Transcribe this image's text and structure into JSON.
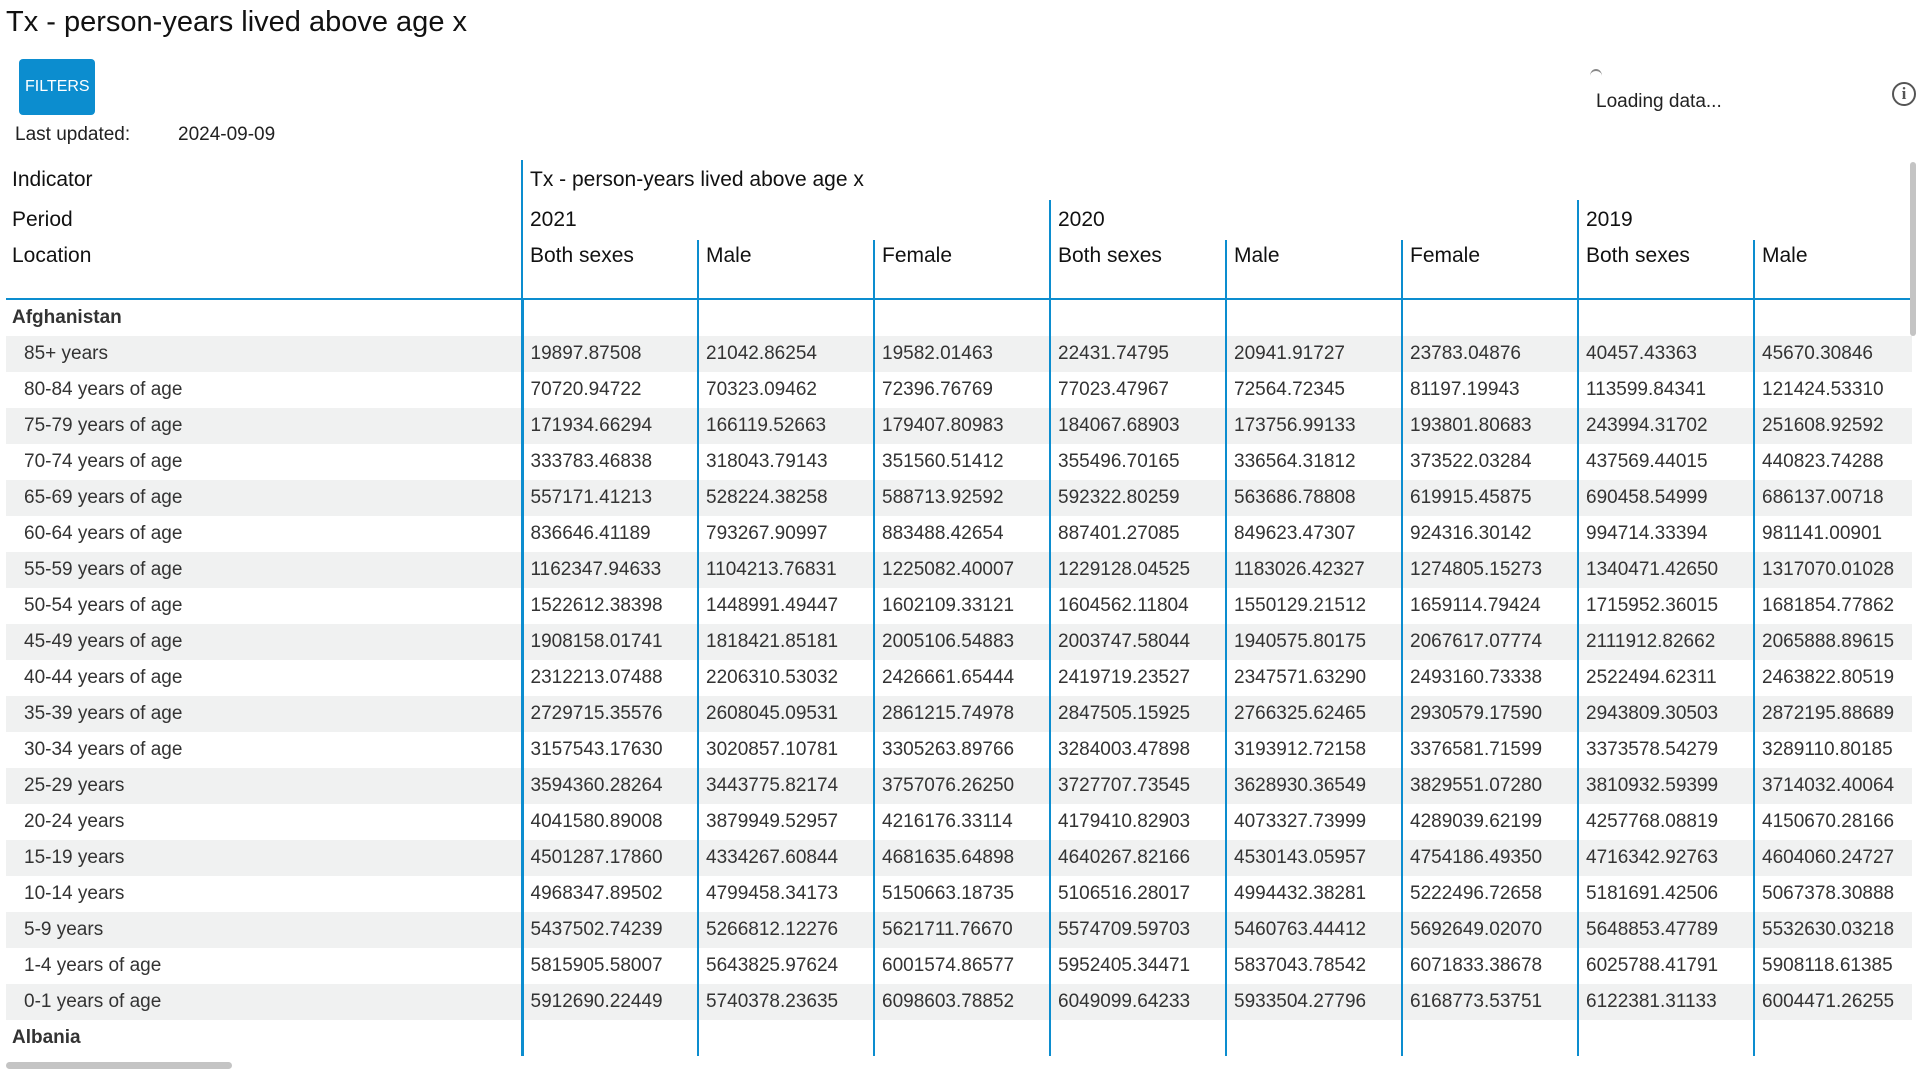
{
  "page": {
    "title": "Tx - person-years lived above age x",
    "filters_label": "FILTERS",
    "last_updated_label": "Last updated:",
    "last_updated_value": "2024-09-09",
    "loading_text": "Loading data...",
    "info_icon": "info-icon"
  },
  "table": {
    "header_labels": {
      "indicator": "Indicator",
      "period": "Period",
      "location": "Location"
    },
    "indicator_value": "Tx - person-years lived above age x",
    "periods": [
      {
        "label": "2021",
        "span": 3
      },
      {
        "label": "2020",
        "span": 3
      },
      {
        "label": "2019",
        "span": 2
      }
    ],
    "sexes": [
      "Both sexes",
      "Male",
      "Female",
      "Both sexes",
      "Male",
      "Female",
      "Both sexes",
      "Male"
    ],
    "groups": [
      {
        "location": "Afghanistan",
        "rows": [
          {
            "age": "85+ years",
            "values": [
              "19897.87508",
              "21042.86254",
              "19582.01463",
              "22431.74795",
              "20941.91727",
              "23783.04876",
              "40457.43363",
              "45670.30846"
            ]
          },
          {
            "age": "80-84 years of age",
            "values": [
              "70720.94722",
              "70323.09462",
              "72396.76769",
              "77023.47967",
              "72564.72345",
              "81197.19943",
              "113599.84341",
              "121424.53310"
            ]
          },
          {
            "age": "75-79 years of age",
            "values": [
              "171934.66294",
              "166119.52663",
              "179407.80983",
              "184067.68903",
              "173756.99133",
              "193801.80683",
              "243994.31702",
              "251608.92592"
            ]
          },
          {
            "age": "70-74 years of age",
            "values": [
              "333783.46838",
              "318043.79143",
              "351560.51412",
              "355496.70165",
              "336564.31812",
              "373522.03284",
              "437569.44015",
              "440823.74288"
            ]
          },
          {
            "age": "65-69 years of age",
            "values": [
              "557171.41213",
              "528224.38258",
              "588713.92592",
              "592322.80259",
              "563686.78808",
              "619915.45875",
              "690458.54999",
              "686137.00718"
            ]
          },
          {
            "age": "60-64 years of age",
            "values": [
              "836646.41189",
              "793267.90997",
              "883488.42654",
              "887401.27085",
              "849623.47307",
              "924316.30142",
              "994714.33394",
              "981141.00901"
            ]
          },
          {
            "age": "55-59 years of age",
            "values": [
              "1162347.94633",
              "1104213.76831",
              "1225082.40007",
              "1229128.04525",
              "1183026.42327",
              "1274805.15273",
              "1340471.42650",
              "1317070.01028"
            ]
          },
          {
            "age": "50-54 years of age",
            "values": [
              "1522612.38398",
              "1448991.49447",
              "1602109.33121",
              "1604562.11804",
              "1550129.21512",
              "1659114.79424",
              "1715952.36015",
              "1681854.77862"
            ]
          },
          {
            "age": "45-49 years of age",
            "values": [
              "1908158.01741",
              "1818421.85181",
              "2005106.54883",
              "2003747.58044",
              "1940575.80175",
              "2067617.07774",
              "2111912.82662",
              "2065888.89615"
            ]
          },
          {
            "age": "40-44 years of age",
            "values": [
              "2312213.07488",
              "2206310.53032",
              "2426661.65444",
              "2419719.23527",
              "2347571.63290",
              "2493160.73338",
              "2522494.62311",
              "2463822.80519"
            ]
          },
          {
            "age": "35-39 years of age",
            "values": [
              "2729715.35576",
              "2608045.09531",
              "2861215.74978",
              "2847505.15925",
              "2766325.62465",
              "2930579.17590",
              "2943809.30503",
              "2872195.88689"
            ]
          },
          {
            "age": "30-34 years of age",
            "values": [
              "3157543.17630",
              "3020857.10781",
              "3305263.89766",
              "3284003.47898",
              "3193912.72158",
              "3376581.71599",
              "3373578.54279",
              "3289110.80185"
            ]
          },
          {
            "age": "25-29 years",
            "values": [
              "3594360.28264",
              "3443775.82174",
              "3757076.26250",
              "3727707.73545",
              "3628930.36549",
              "3829551.07280",
              "3810932.59399",
              "3714032.40064"
            ]
          },
          {
            "age": "20-24 years",
            "values": [
              "4041580.89008",
              "3879949.52957",
              "4216176.33114",
              "4179410.82903",
              "4073327.73999",
              "4289039.62199",
              "4257768.08819",
              "4150670.28166"
            ]
          },
          {
            "age": "15-19 years",
            "values": [
              "4501287.17860",
              "4334267.60844",
              "4681635.64898",
              "4640267.82166",
              "4530143.05957",
              "4754186.49350",
              "4716342.92763",
              "4604060.24727"
            ]
          },
          {
            "age": "10-14 years",
            "values": [
              "4968347.89502",
              "4799458.34173",
              "5150663.18735",
              "5106516.28017",
              "4994432.38281",
              "5222496.72658",
              "5181691.42506",
              "5067378.30888"
            ]
          },
          {
            "age": "5-9 years",
            "values": [
              "5437502.74239",
              "5266812.12276",
              "5621711.76670",
              "5574709.59703",
              "5460763.44412",
              "5692649.02070",
              "5648853.47789",
              "5532630.03218"
            ]
          },
          {
            "age": "1-4 years of age",
            "values": [
              "5815905.58007",
              "5643825.97624",
              "6001574.86577",
              "5952405.34471",
              "5837043.78542",
              "6071833.38678",
              "6025788.41791",
              "5908118.61385"
            ]
          },
          {
            "age": "0-1 years of age",
            "values": [
              "5912690.22449",
              "5740378.23635",
              "6098603.78852",
              "6049099.64233",
              "5933504.27796",
              "6168773.53751",
              "6122381.31133",
              "6004471.26255"
            ]
          }
        ]
      },
      {
        "location": "Albania",
        "rows": []
      }
    ]
  }
}
